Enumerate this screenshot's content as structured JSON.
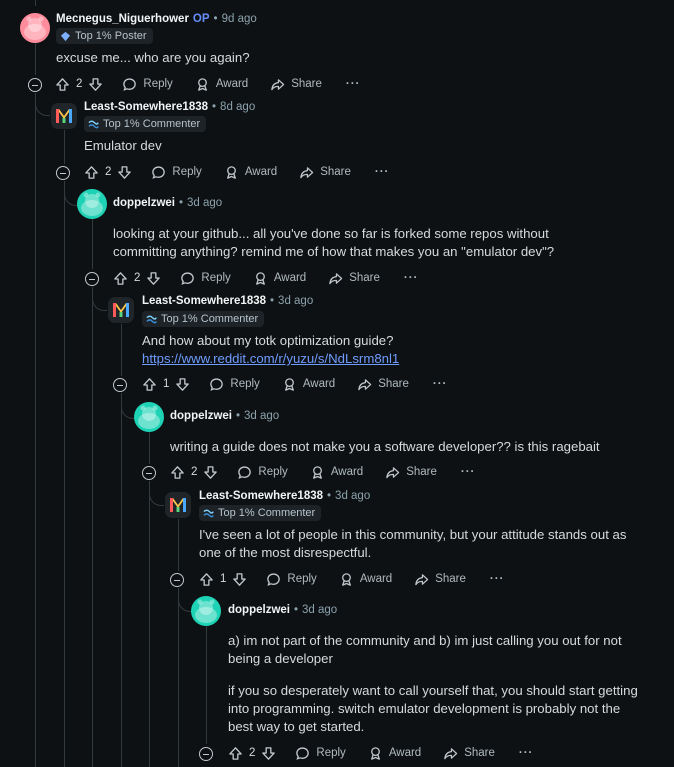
{
  "labels": {
    "reply": "Reply",
    "award": "Award",
    "share": "Share",
    "more": "···",
    "op": "OP",
    "sep": "•"
  },
  "comments": [
    {
      "author": "Mecnegus_Niguerhower",
      "time": "9d ago",
      "flair": "Top 1% Poster",
      "body": [
        "excuse me... who are you again?"
      ],
      "votes": "2"
    },
    {
      "author": "Least-Somewhere1838",
      "time": "8d ago",
      "flair": "Top 1% Commenter",
      "body": [
        "Emulator dev"
      ],
      "votes": "2"
    },
    {
      "author": "doppelzwei",
      "time": "3d ago",
      "body": [
        "looking at your github... all you've done so far is forked some repos without committing anything? remind me of how that makes you an \"emulator dev\"?"
      ],
      "votes": "2"
    },
    {
      "author": "Least-Somewhere1838",
      "time": "3d ago",
      "flair": "Top 1% Commenter",
      "body": [
        "And how about my totk optimization guide?"
      ],
      "link": "https://www.reddit.com/r/yuzu/s/NdLsrm8nl1",
      "votes": "1"
    },
    {
      "author": "doppelzwei",
      "time": "3d ago",
      "body": [
        "writing a guide does not make you a software developer?? is this ragebait"
      ],
      "votes": "2"
    },
    {
      "author": "Least-Somewhere1838",
      "time": "3d ago",
      "flair": "Top 1% Commenter",
      "body": [
        "I've seen a lot of people in this community, but your attitude stands out as one of the most disrespectful."
      ],
      "votes": "1"
    },
    {
      "author": "doppelzwei",
      "time": "3d ago",
      "body": [
        "a) im not part of the community and b) im just calling you out for not being a developer",
        "if you so desperately want to call yourself that, you should start getting into programming. switch emulator development is probably not the best way to get started."
      ],
      "votes": "2"
    }
  ]
}
